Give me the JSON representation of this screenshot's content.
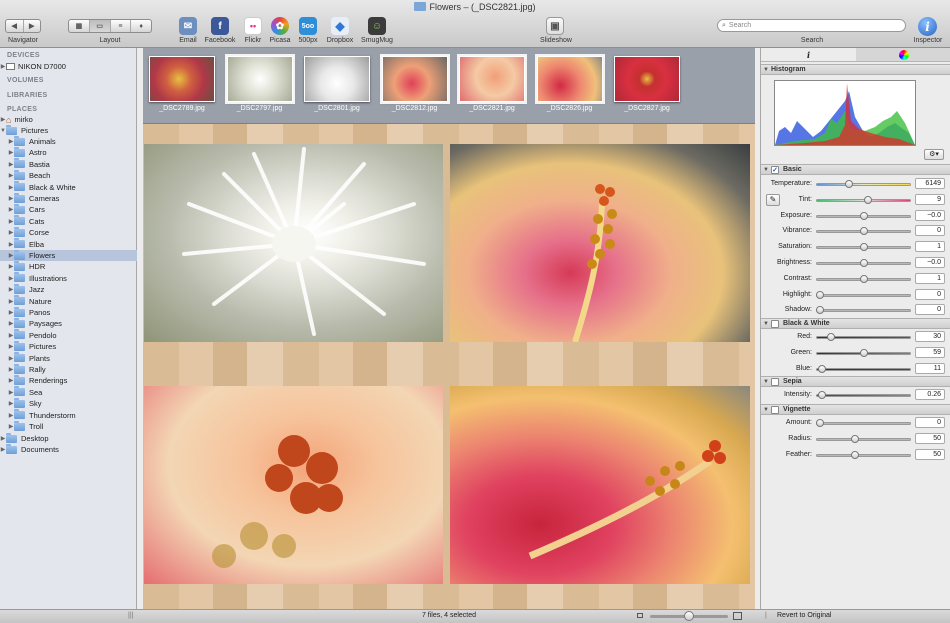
{
  "window": {
    "title": "Flowers – (_DSC2821.jpg)"
  },
  "toolbar": {
    "navigator_label": "Navigator",
    "layout_label": "Layout",
    "share_items": [
      {
        "label": "Email",
        "icon": "email-icon",
        "color": "#6c8fbf"
      },
      {
        "label": "Facebook",
        "icon": "facebook-icon",
        "color": "#3b5998"
      },
      {
        "label": "Flickr",
        "icon": "flickr-icon",
        "color": "#ffffff"
      },
      {
        "label": "Picasa",
        "icon": "picasa-icon",
        "color": "#f0a020"
      },
      {
        "label": "500px",
        "icon": "500px-icon",
        "color": "#2f8ed8"
      },
      {
        "label": "Dropbox",
        "icon": "dropbox-icon",
        "color": "#2e7ad1"
      },
      {
        "label": "SmugMug",
        "icon": "smugmug-icon",
        "color": "#3b3b3b"
      }
    ],
    "slideshow_label": "Slideshow",
    "search_placeholder": "Search",
    "search_label": "Search",
    "inspector_label": "Inspector",
    "inspector_glyph": "i",
    "icon_glyphs": {
      "back": "◀",
      "forward": "▶",
      "grid": "▦",
      "filmstrip": "▭",
      "list": "≡",
      "pin": "♦",
      "email": "✉",
      "facebook": "f",
      "flickr": "••",
      "picasa": "✿",
      "500px": "5oo",
      "dropbox": "◆",
      "smugmug": "☺",
      "slideshow": "▣",
      "search": "⌕"
    }
  },
  "sidebar": {
    "sections": {
      "devices": "DEVICES",
      "volumes": "VOLUMES",
      "libraries": "LIBRARIES",
      "places": "PLACES"
    },
    "device": "NIKON D7000",
    "home": "mirko",
    "pictures": "Pictures",
    "folders": [
      "Animals",
      "Astro",
      "Bastia",
      "Beach",
      "Black & White",
      "Cameras",
      "Cars",
      "Cats",
      "Corse",
      "Elba",
      "Flowers",
      "HDR",
      "Illustrations",
      "Jazz",
      "Nature",
      "Panos",
      "Paysages",
      "Pendolo",
      "Pictures",
      "Plants",
      "Rally",
      "Renderings",
      "Sea",
      "Sky",
      "Thunderstorm",
      "Troll"
    ],
    "selected": "Flowers",
    "root_folders": [
      "Desktop",
      "Documents"
    ]
  },
  "filmstrip": [
    {
      "name": "_DSC2789.jpg",
      "selected": false
    },
    {
      "name": "_DSC2797.jpg",
      "selected": true
    },
    {
      "name": "_DSC2801.jpg",
      "selected": false
    },
    {
      "name": "_DSC2812.jpg",
      "selected": true
    },
    {
      "name": "_DSC2821.jpg",
      "selected": true
    },
    {
      "name": "_DSC2826.jpg",
      "selected": true
    },
    {
      "name": "_DSC2827.jpg",
      "selected": false
    }
  ],
  "inspector": {
    "histogram_title": "Histogram",
    "basic_title": "Basic",
    "basic_checked": true,
    "basic": [
      {
        "label": "Temperature:",
        "value": "6149",
        "level": 0.33,
        "track": "linear-gradient(90deg,#5b8fe0,#e8e8c0,#f2d84a)"
      },
      {
        "label": "Tint:",
        "value": "9",
        "level": 0.55,
        "track": "linear-gradient(90deg,#38c06a,#ddd,#e03c7a)"
      },
      {
        "label": "Exposure:",
        "value": "−0.0",
        "level": 0.5,
        "track": ""
      },
      {
        "label": "Vibrance:",
        "value": "0",
        "level": 0.5,
        "track": ""
      },
      {
        "label": "Saturation:",
        "value": "1",
        "level": 0.5,
        "track": ""
      },
      {
        "label": "Brightness:",
        "value": "−0.0",
        "level": 0.5,
        "track": ""
      },
      {
        "label": "Contrast:",
        "value": "1",
        "level": 0.5,
        "track": ""
      },
      {
        "label": "Highlight:",
        "value": "0",
        "level": 0.0,
        "track": ""
      },
      {
        "label": "Shadow:",
        "value": "0",
        "level": 0.0,
        "track": ""
      }
    ],
    "bw_title": "Black & White",
    "bw_checked": false,
    "bw": [
      {
        "label": "Red:",
        "value": "30",
        "level": 0.13,
        "track": "linear-gradient(90deg,#333,#e32020)"
      },
      {
        "label": "Green:",
        "value": "59",
        "level": 0.5,
        "track": "linear-gradient(90deg,#333,#28c028)"
      },
      {
        "label": "Blue:",
        "value": "11",
        "level": 0.02,
        "track": "linear-gradient(90deg,#333,#2040e0)"
      }
    ],
    "sepia_title": "Sepia",
    "sepia_checked": false,
    "sepia": [
      {
        "label": "Intensity:",
        "value": "0.26",
        "level": 0.02,
        "track": "linear-gradient(90deg,#444,#c08040)"
      }
    ],
    "vignette_title": "Vignette",
    "vignette_checked": false,
    "vignette": [
      {
        "label": "Amount:",
        "value": "0",
        "level": 0.0,
        "track": ""
      },
      {
        "label": "Radius:",
        "value": "50",
        "level": 0.4,
        "track": ""
      },
      {
        "label": "Feather:",
        "value": "50",
        "level": 0.4,
        "track": ""
      }
    ]
  },
  "status": {
    "text": "7 files, 4 selected",
    "revert_label": "Revert to Original"
  },
  "colors": {
    "selection": "#b7c5dc",
    "accent": "#2461c4"
  }
}
